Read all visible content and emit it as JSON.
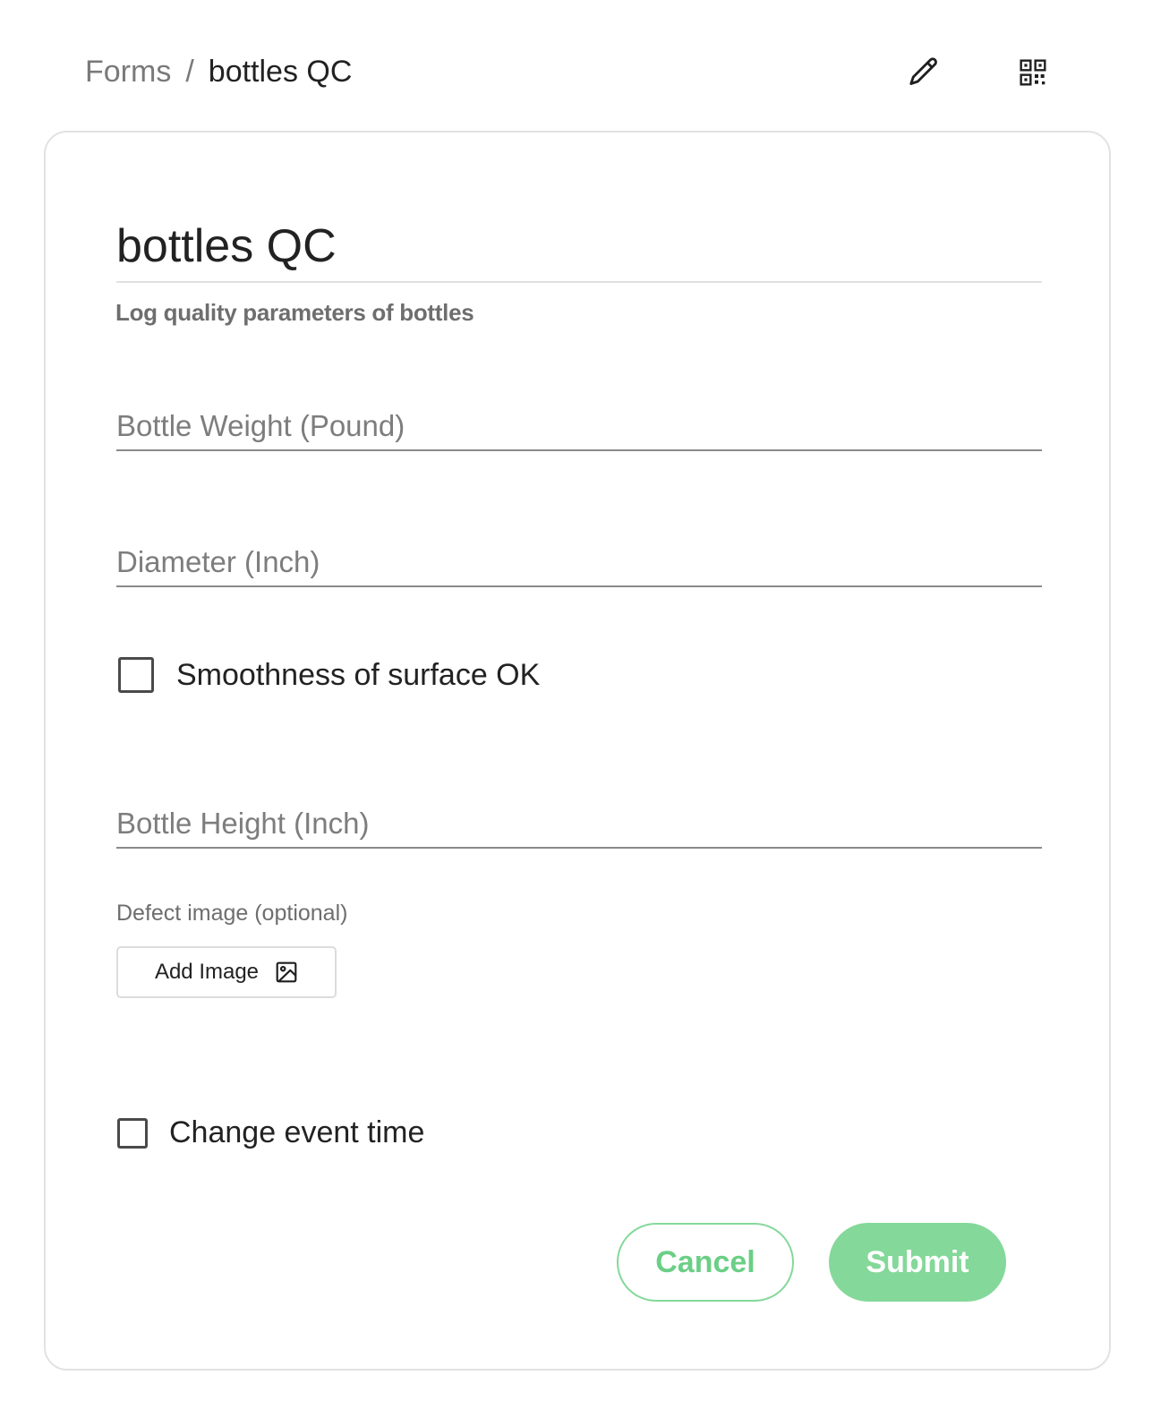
{
  "breadcrumb": {
    "root": "Forms",
    "separator": "/",
    "current": "bottles QC"
  },
  "toolbar": {
    "edit_icon": "pencil-icon",
    "qr_icon": "qr-code-icon"
  },
  "form": {
    "title": "bottles QC",
    "description": "Log quality parameters of bottles",
    "fields": {
      "weight_placeholder": "Bottle Weight (Pound)",
      "diameter_placeholder": "Diameter (Inch)",
      "height_placeholder": "Bottle Height (Inch)"
    },
    "smoothness_label": "Smoothness of surface OK",
    "smoothness_checked": false,
    "defect_image_label": "Defect image (optional)",
    "add_image_label": "Add Image",
    "add_image_icon": "image-icon",
    "change_time_label": "Change event time",
    "change_time_checked": false
  },
  "actions": {
    "cancel_label": "Cancel",
    "submit_label": "Submit"
  },
  "colors": {
    "accent": "#84d89a",
    "accent_text": "#6bcf86",
    "muted_text": "#7a7a7a"
  }
}
